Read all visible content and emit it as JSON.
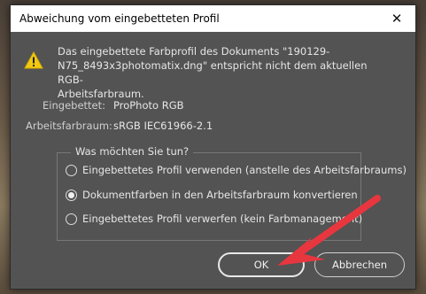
{
  "dialog": {
    "title": "Abweichung vom eingebetteten Profil",
    "close_glyph": "✕"
  },
  "message": "Das eingebettete Farbprofil des Dokuments \"190129-\nN75_8493x3photomatix.dng\" entspricht nicht dem aktuellen RGB-\nArbeitsfarbraum.",
  "info": {
    "embedded_label": "Eingebettet:",
    "embedded_value": "ProPhoto RGB",
    "working_label": "Arbeitsfarbraum:",
    "working_value": "sRGB IEC61966-2.1"
  },
  "options": {
    "legend": "Was möchten Sie tun?",
    "items": [
      {
        "label": "Eingebettetes Profil verwenden (anstelle des Arbeitsfarbraums)",
        "checked": false
      },
      {
        "label": "Dokumentfarben in den Arbeitsfarbraum konvertieren",
        "checked": true
      },
      {
        "label": "Eingebettetes Profil verwerfen (kein Farbmanagement)",
        "checked": false
      }
    ]
  },
  "buttons": {
    "ok": "OK",
    "cancel": "Abbrechen"
  },
  "icons": {
    "warning": "warning-icon",
    "close": "close-icon",
    "annotation": "annotation-arrow"
  },
  "colors": {
    "dialog_bg": "#535353",
    "warning": "#f2c811",
    "arrow": "#e8363f"
  }
}
